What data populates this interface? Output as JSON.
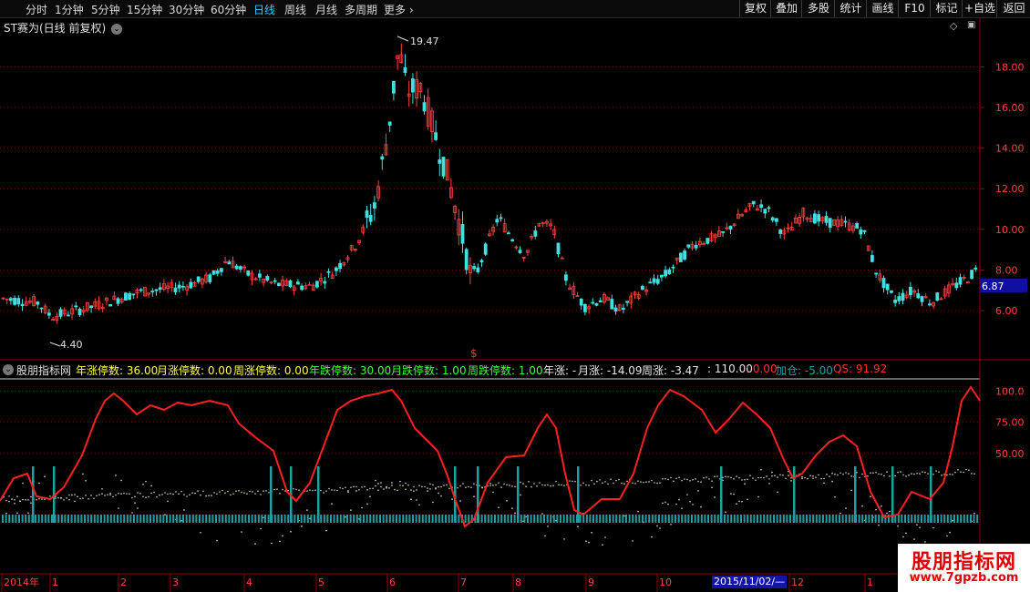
{
  "toolbar": {
    "periods": [
      "分时",
      "1分钟",
      "5分钟",
      "15分钟",
      "30分钟",
      "60分钟",
      "日线",
      "周线",
      "月线",
      "多周期",
      "更多"
    ],
    "active_period": "日线",
    "right_buttons": [
      "复权",
      "叠加",
      "多股",
      "统计",
      "画线",
      "F10",
      "标记",
      "+自选",
      "返回"
    ]
  },
  "stock": {
    "title": "ST赛为(日线 前复权)"
  },
  "price_chart": {
    "y_ticks": [
      "18.00",
      "16.00",
      "14.00",
      "12.00",
      "10.00",
      "8.00",
      "6.00"
    ],
    "current_price": "6.87",
    "high_label": "19.47",
    "low_label": "4.40",
    "marker": "$"
  },
  "indicator": {
    "name": "股朋指标网",
    "fields": [
      {
        "label": "年涨停数: 36.00",
        "color": "#ffff40"
      },
      {
        "label": "月涨停数: 0.00",
        "color": "#ffff40"
      },
      {
        "label": "周涨停数: 0.00",
        "color": "#ffff40"
      },
      {
        "label": "年跌停数: 30.00",
        "color": "#40ff40"
      },
      {
        "label": "月跌停数: 1.00",
        "color": "#40ff40"
      },
      {
        "label": "周跌停数: 1.00",
        "color": "#40ff40"
      },
      {
        "label": "年涨: -",
        "color": "#e8e8e8"
      },
      {
        "label": "月涨: -14.09",
        "color": "#e8e8e8"
      },
      {
        "label": "周涨: -3.47",
        "color": "#e8e8e8"
      },
      {
        "label": ": 110.00",
        "color": "#e8e8e8"
      },
      {
        "label": ": 0.00",
        "color": "#ff3030"
      },
      {
        "label": "加仓: -5.00",
        "color": "#20a0a0"
      },
      {
        "label": "QS: 91.92",
        "color": "#ff3030"
      }
    ],
    "y_ticks": [
      "100.0",
      "75.00",
      "50.00"
    ]
  },
  "time_axis": {
    "labels": [
      "2014年",
      "1",
      "2",
      "3",
      "4",
      "5",
      "6",
      "7",
      "8",
      "9",
      "10",
      "12",
      "1"
    ],
    "selected_date": "2015/11/02/—"
  },
  "watermark": {
    "line1": "股朋指标网",
    "line2": "www.7gpzb.com"
  },
  "colors": {
    "up": "#ff4040",
    "down": "#40e0e0",
    "grid": "#8b0000",
    "qs_line": "#ff2020",
    "bars": "#20a0a0"
  }
}
